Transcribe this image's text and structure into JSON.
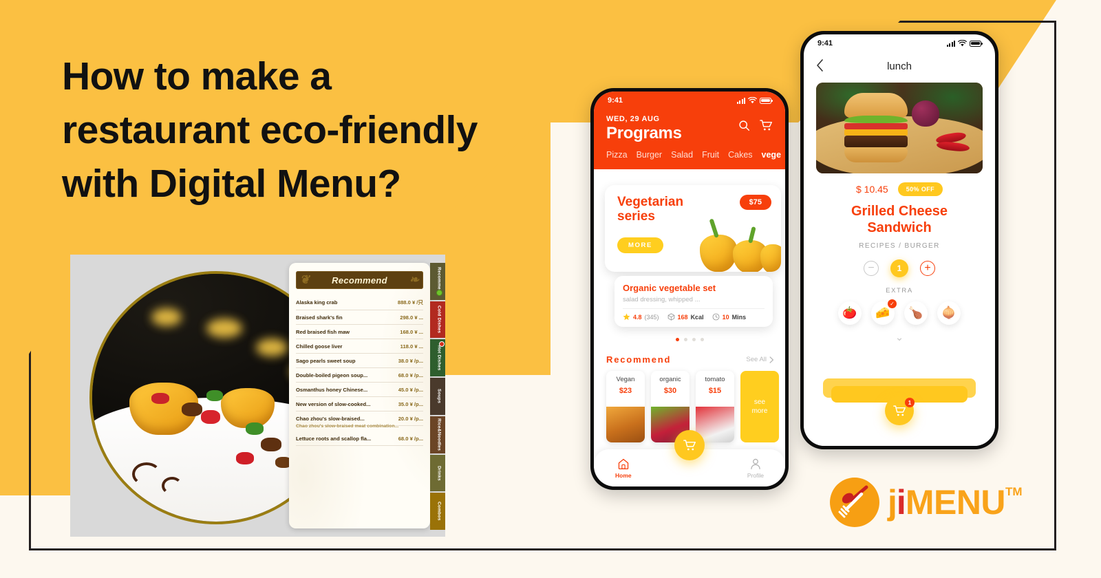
{
  "colors": {
    "yellow_bg": "#FBC042",
    "cream_bg": "#FDF8EF",
    "orange_brand": "#F73F0B",
    "amber": "#FFC81F",
    "logo_orange": "#F9A31A",
    "logo_red": "#D92B2B",
    "frame_dark": "#231f20"
  },
  "headline": {
    "line1": "How to make a",
    "line2": "restaurant eco-friendly",
    "line3": "with Digital Menu?"
  },
  "digital_menu": {
    "card_title": "Recommend",
    "ornament_icon": "flourish-ornament",
    "items": [
      {
        "name": "Alaska king crab",
        "price": "888.0 ¥",
        "unit": "/只"
      },
      {
        "name": "Braised shark's fin",
        "price": "298.0 ¥",
        "unit": "..."
      },
      {
        "name": "Red braised fish maw",
        "price": "168.0 ¥",
        "unit": "..."
      },
      {
        "name": "Chilled goose liver",
        "price": "118.0 ¥",
        "unit": "..."
      },
      {
        "name": "Sago pearls sweet soup",
        "price": "38.0 ¥",
        "unit": "/p..."
      },
      {
        "name": "Double-boiled pigeon soup...",
        "price": "68.0 ¥",
        "unit": "/p..."
      },
      {
        "name": "Osmanthus honey Chinese...",
        "price": "45.0 ¥",
        "unit": "/p..."
      },
      {
        "name": "New version of slow-cooked...",
        "price": "35.0 ¥",
        "unit": "/p..."
      },
      {
        "name": "Chao zhou's slow-braised...",
        "price": "20.0 ¥",
        "unit": "/p...",
        "sub": "Chao zhou's slow-braised meat combination..."
      },
      {
        "name": "Lettuce roots and scallop fla...",
        "price": "68.0 ¥",
        "unit": "/p..."
      }
    ],
    "tabs": [
      {
        "label": "Recommend",
        "color": "#5C5A32",
        "dot": true
      },
      {
        "label": "Cold Dishes",
        "color": "#B22A20",
        "dot": false
      },
      {
        "label": "Hot Dishes",
        "color": "#2E5E2E",
        "dot": false,
        "badge": true
      },
      {
        "label": "Soups",
        "color": "#4A3A2C",
        "dot": false
      },
      {
        "label": "Rice&Noodles",
        "color": "#6B4526",
        "dot": false
      },
      {
        "label": "Drinks",
        "color": "#6E6B33",
        "dot": false
      },
      {
        "label": "Combos",
        "color": "#9A7208",
        "dot": false
      }
    ]
  },
  "phone1": {
    "status": {
      "time": "9:41",
      "signal_icon": "signal-bars-icon",
      "wifi_icon": "wifi-icon",
      "battery_icon": "battery-full-icon"
    },
    "date": "WED, 29 AUG",
    "title": "Programs",
    "search_icon": "search-icon",
    "cart_icon": "cart-icon",
    "chips": [
      "Pizza",
      "Burger",
      "Salad",
      "Fruit",
      "Cakes",
      "vege"
    ],
    "active_chip": "vege",
    "promo": {
      "title_line1": "Vegetarian",
      "title_line2": "series",
      "price": "$75",
      "more_label": "MORE"
    },
    "info": {
      "title": "Organic vegetable set",
      "desc": "salad dressing, whipped ...",
      "rating": "4.8",
      "rating_count": "(345)",
      "calories": "168",
      "calories_unit": "Kcal",
      "time": "10",
      "time_unit": "Mins",
      "star_icon": "star-icon",
      "box_icon": "box-icon",
      "clock_icon": "clock-icon"
    },
    "carousel_dots": 4,
    "carousel_active": 0,
    "recommend": {
      "heading": "Recommend",
      "see_all": "See All",
      "chevron_icon": "chevron-right-icon",
      "cards": [
        {
          "name": "Vegan",
          "price": "$23"
        },
        {
          "name": "organic",
          "price": "$30"
        },
        {
          "name": "tomato",
          "price": "$15"
        }
      ],
      "see_more_line1": "see",
      "see_more_line2": "more"
    },
    "tabbar": {
      "home_label": "Home",
      "home_icon": "home-icon",
      "profile_label": "Profile",
      "profile_icon": "person-icon",
      "fab_icon": "cart-icon"
    }
  },
  "phone2": {
    "status": {
      "time": "9:41",
      "signal_icon": "signal-bars-icon",
      "wifi_icon": "wifi-icon",
      "battery_icon": "battery-full-icon"
    },
    "back_icon": "chevron-left-icon",
    "nav_title": "lunch",
    "hero_image_alt": "grilled-cheese-sandwich-photo",
    "price": "$ 10.45",
    "discount": "50% OFF",
    "title_line1": "Grilled Cheese",
    "title_line2": "Sandwich",
    "category": "RECIPES / BURGER",
    "qty": {
      "minus_icon": "minus-circle-icon",
      "value": "1",
      "plus_icon": "plus-circle-icon"
    },
    "extra_label": "EXTRA",
    "extras": [
      {
        "name": "tomato",
        "icon": "tomato-icon",
        "glyph": "🍅",
        "selected": false
      },
      {
        "name": "cheese",
        "icon": "cheese-icon",
        "glyph": "🧀",
        "selected": true
      },
      {
        "name": "chicken",
        "icon": "chicken-leg-icon",
        "glyph": "🍗",
        "selected": false
      },
      {
        "name": "onion",
        "icon": "onion-icon",
        "glyph": "🧅",
        "selected": false
      }
    ],
    "expand_icon": "chevron-down-icon",
    "check_glyph": "✓",
    "fab_icon": "cart-icon",
    "fab_badge": "1"
  },
  "logo": {
    "mark_icon": "spoon-fork-circle-icon",
    "ji": "ji",
    "j": "j",
    "i": "i",
    "menu": "MENU",
    "tm": "TM"
  }
}
